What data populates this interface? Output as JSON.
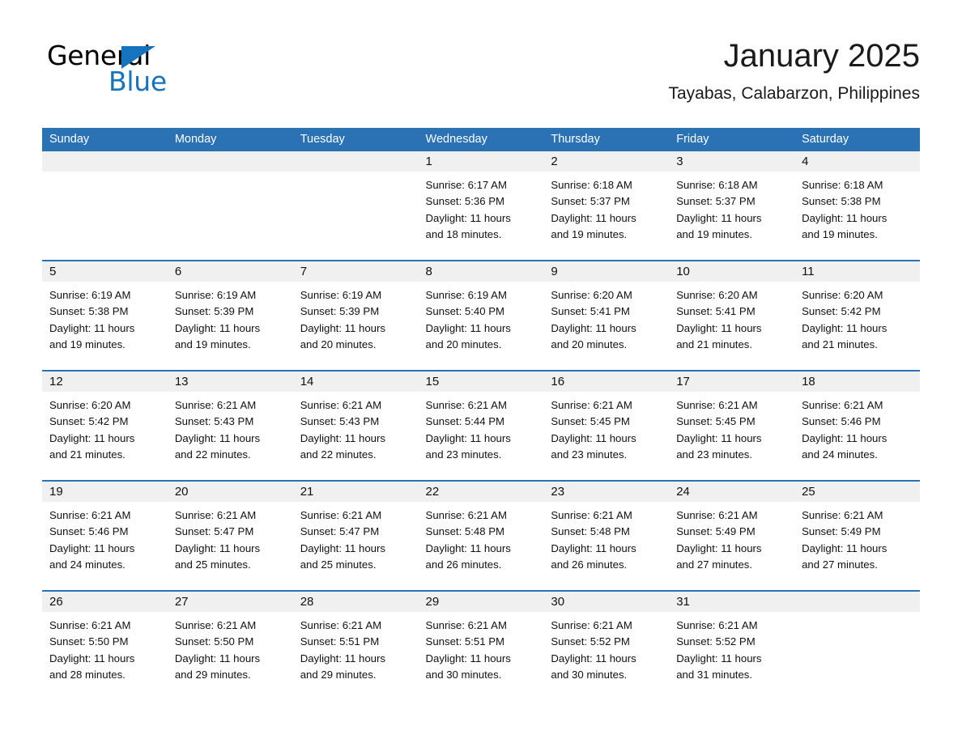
{
  "brand": {
    "name_part1": "General",
    "name_part2": "Blue",
    "flag_icon": "triangle-flag-icon",
    "accent_color": "#1673be"
  },
  "header": {
    "title": "January 2025",
    "subtitle": "Tayabas, Calabarzon, Philippines"
  },
  "theme": {
    "header_bar_color": "#2b72b4",
    "daynum_band_color": "#f0f0f0",
    "week_rule_color": "#2b72b4",
    "text_color": "#111111"
  },
  "weekdays": [
    "Sunday",
    "Monday",
    "Tuesday",
    "Wednesday",
    "Thursday",
    "Friday",
    "Saturday"
  ],
  "weeks": [
    [
      {
        "day": "",
        "sunrise": "",
        "sunset": "",
        "daylight_line1": "",
        "daylight_line2": ""
      },
      {
        "day": "",
        "sunrise": "",
        "sunset": "",
        "daylight_line1": "",
        "daylight_line2": ""
      },
      {
        "day": "",
        "sunrise": "",
        "sunset": "",
        "daylight_line1": "",
        "daylight_line2": ""
      },
      {
        "day": "1",
        "sunrise": "Sunrise: 6:17 AM",
        "sunset": "Sunset: 5:36 PM",
        "daylight_line1": "Daylight: 11 hours",
        "daylight_line2": "and 18 minutes."
      },
      {
        "day": "2",
        "sunrise": "Sunrise: 6:18 AM",
        "sunset": "Sunset: 5:37 PM",
        "daylight_line1": "Daylight: 11 hours",
        "daylight_line2": "and 19 minutes."
      },
      {
        "day": "3",
        "sunrise": "Sunrise: 6:18 AM",
        "sunset": "Sunset: 5:37 PM",
        "daylight_line1": "Daylight: 11 hours",
        "daylight_line2": "and 19 minutes."
      },
      {
        "day": "4",
        "sunrise": "Sunrise: 6:18 AM",
        "sunset": "Sunset: 5:38 PM",
        "daylight_line1": "Daylight: 11 hours",
        "daylight_line2": "and 19 minutes."
      }
    ],
    [
      {
        "day": "5",
        "sunrise": "Sunrise: 6:19 AM",
        "sunset": "Sunset: 5:38 PM",
        "daylight_line1": "Daylight: 11 hours",
        "daylight_line2": "and 19 minutes."
      },
      {
        "day": "6",
        "sunrise": "Sunrise: 6:19 AM",
        "sunset": "Sunset: 5:39 PM",
        "daylight_line1": "Daylight: 11 hours",
        "daylight_line2": "and 19 minutes."
      },
      {
        "day": "7",
        "sunrise": "Sunrise: 6:19 AM",
        "sunset": "Sunset: 5:39 PM",
        "daylight_line1": "Daylight: 11 hours",
        "daylight_line2": "and 20 minutes."
      },
      {
        "day": "8",
        "sunrise": "Sunrise: 6:19 AM",
        "sunset": "Sunset: 5:40 PM",
        "daylight_line1": "Daylight: 11 hours",
        "daylight_line2": "and 20 minutes."
      },
      {
        "day": "9",
        "sunrise": "Sunrise: 6:20 AM",
        "sunset": "Sunset: 5:41 PM",
        "daylight_line1": "Daylight: 11 hours",
        "daylight_line2": "and 20 minutes."
      },
      {
        "day": "10",
        "sunrise": "Sunrise: 6:20 AM",
        "sunset": "Sunset: 5:41 PM",
        "daylight_line1": "Daylight: 11 hours",
        "daylight_line2": "and 21 minutes."
      },
      {
        "day": "11",
        "sunrise": "Sunrise: 6:20 AM",
        "sunset": "Sunset: 5:42 PM",
        "daylight_line1": "Daylight: 11 hours",
        "daylight_line2": "and 21 minutes."
      }
    ],
    [
      {
        "day": "12",
        "sunrise": "Sunrise: 6:20 AM",
        "sunset": "Sunset: 5:42 PM",
        "daylight_line1": "Daylight: 11 hours",
        "daylight_line2": "and 21 minutes."
      },
      {
        "day": "13",
        "sunrise": "Sunrise: 6:21 AM",
        "sunset": "Sunset: 5:43 PM",
        "daylight_line1": "Daylight: 11 hours",
        "daylight_line2": "and 22 minutes."
      },
      {
        "day": "14",
        "sunrise": "Sunrise: 6:21 AM",
        "sunset": "Sunset: 5:43 PM",
        "daylight_line1": "Daylight: 11 hours",
        "daylight_line2": "and 22 minutes."
      },
      {
        "day": "15",
        "sunrise": "Sunrise: 6:21 AM",
        "sunset": "Sunset: 5:44 PM",
        "daylight_line1": "Daylight: 11 hours",
        "daylight_line2": "and 23 minutes."
      },
      {
        "day": "16",
        "sunrise": "Sunrise: 6:21 AM",
        "sunset": "Sunset: 5:45 PM",
        "daylight_line1": "Daylight: 11 hours",
        "daylight_line2": "and 23 minutes."
      },
      {
        "day": "17",
        "sunrise": "Sunrise: 6:21 AM",
        "sunset": "Sunset: 5:45 PM",
        "daylight_line1": "Daylight: 11 hours",
        "daylight_line2": "and 23 minutes."
      },
      {
        "day": "18",
        "sunrise": "Sunrise: 6:21 AM",
        "sunset": "Sunset: 5:46 PM",
        "daylight_line1": "Daylight: 11 hours",
        "daylight_line2": "and 24 minutes."
      }
    ],
    [
      {
        "day": "19",
        "sunrise": "Sunrise: 6:21 AM",
        "sunset": "Sunset: 5:46 PM",
        "daylight_line1": "Daylight: 11 hours",
        "daylight_line2": "and 24 minutes."
      },
      {
        "day": "20",
        "sunrise": "Sunrise: 6:21 AM",
        "sunset": "Sunset: 5:47 PM",
        "daylight_line1": "Daylight: 11 hours",
        "daylight_line2": "and 25 minutes."
      },
      {
        "day": "21",
        "sunrise": "Sunrise: 6:21 AM",
        "sunset": "Sunset: 5:47 PM",
        "daylight_line1": "Daylight: 11 hours",
        "daylight_line2": "and 25 minutes."
      },
      {
        "day": "22",
        "sunrise": "Sunrise: 6:21 AM",
        "sunset": "Sunset: 5:48 PM",
        "daylight_line1": "Daylight: 11 hours",
        "daylight_line2": "and 26 minutes."
      },
      {
        "day": "23",
        "sunrise": "Sunrise: 6:21 AM",
        "sunset": "Sunset: 5:48 PM",
        "daylight_line1": "Daylight: 11 hours",
        "daylight_line2": "and 26 minutes."
      },
      {
        "day": "24",
        "sunrise": "Sunrise: 6:21 AM",
        "sunset": "Sunset: 5:49 PM",
        "daylight_line1": "Daylight: 11 hours",
        "daylight_line2": "and 27 minutes."
      },
      {
        "day": "25",
        "sunrise": "Sunrise: 6:21 AM",
        "sunset": "Sunset: 5:49 PM",
        "daylight_line1": "Daylight: 11 hours",
        "daylight_line2": "and 27 minutes."
      }
    ],
    [
      {
        "day": "26",
        "sunrise": "Sunrise: 6:21 AM",
        "sunset": "Sunset: 5:50 PM",
        "daylight_line1": "Daylight: 11 hours",
        "daylight_line2": "and 28 minutes."
      },
      {
        "day": "27",
        "sunrise": "Sunrise: 6:21 AM",
        "sunset": "Sunset: 5:50 PM",
        "daylight_line1": "Daylight: 11 hours",
        "daylight_line2": "and 29 minutes."
      },
      {
        "day": "28",
        "sunrise": "Sunrise: 6:21 AM",
        "sunset": "Sunset: 5:51 PM",
        "daylight_line1": "Daylight: 11 hours",
        "daylight_line2": "and 29 minutes."
      },
      {
        "day": "29",
        "sunrise": "Sunrise: 6:21 AM",
        "sunset": "Sunset: 5:51 PM",
        "daylight_line1": "Daylight: 11 hours",
        "daylight_line2": "and 30 minutes."
      },
      {
        "day": "30",
        "sunrise": "Sunrise: 6:21 AM",
        "sunset": "Sunset: 5:52 PM",
        "daylight_line1": "Daylight: 11 hours",
        "daylight_line2": "and 30 minutes."
      },
      {
        "day": "31",
        "sunrise": "Sunrise: 6:21 AM",
        "sunset": "Sunset: 5:52 PM",
        "daylight_line1": "Daylight: 11 hours",
        "daylight_line2": "and 31 minutes."
      },
      {
        "day": "",
        "sunrise": "",
        "sunset": "",
        "daylight_line1": "",
        "daylight_line2": ""
      }
    ]
  ]
}
